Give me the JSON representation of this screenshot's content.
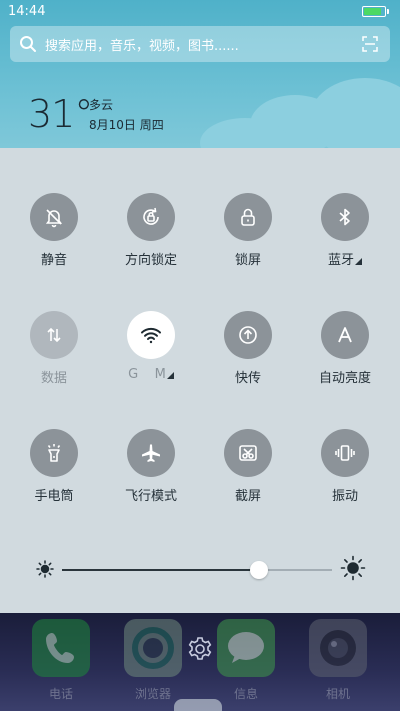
{
  "status_bar": {
    "time": "14:44",
    "battery_level": 0.9,
    "battery_color": "#4cd964"
  },
  "search": {
    "placeholder": "搜索应用，音乐，视频，图书......",
    "search_icon": "search-icon",
    "scan_icon": "scan-icon"
  },
  "weather": {
    "temperature": "31°",
    "condition": "多云",
    "date": "8月10日 周四"
  },
  "toggles": [
    {
      "label": "静音",
      "icon": "bell-off-icon",
      "state": "off"
    },
    {
      "label": "方向锁定",
      "icon": "rotation-lock-icon",
      "state": "off"
    },
    {
      "label": "锁屏",
      "icon": "lock-icon",
      "state": "off"
    },
    {
      "label": "蓝牙",
      "icon": "bluetooth-icon",
      "state": "off"
    },
    {
      "label": "数据",
      "icon": "data-arrows-icon",
      "state": "disabled"
    },
    {
      "label": "G    M",
      "icon": "wifi-icon",
      "state": "on"
    },
    {
      "label": "快传",
      "icon": "quick-transfer-icon",
      "state": "off"
    },
    {
      "label": "自动亮度",
      "icon": "auto-brightness-icon",
      "state": "off"
    },
    {
      "label": "手电筒",
      "icon": "flashlight-icon",
      "state": "off"
    },
    {
      "label": "飞行模式",
      "icon": "airplane-icon",
      "state": "off"
    },
    {
      "label": "截屏",
      "icon": "screenshot-icon",
      "state": "off"
    },
    {
      "label": "振动",
      "icon": "vibrate-icon",
      "state": "off"
    }
  ],
  "brightness": {
    "level": 0.73,
    "low_icon": "sun-small-icon",
    "high_icon": "sun-large-icon"
  },
  "dock": {
    "apps": [
      {
        "label": "电话",
        "icon": "phone-icon",
        "color": "#1e8a3b"
      },
      {
        "label": "浏览器",
        "icon": "browser-icon",
        "color": "#6f8a7c"
      },
      {
        "label": "信息",
        "icon": "message-icon",
        "color": "#3f9a4a"
      },
      {
        "label": "相机",
        "icon": "camera-icon",
        "color": "#5d6270"
      }
    ],
    "settings_icon": "gear-icon"
  }
}
